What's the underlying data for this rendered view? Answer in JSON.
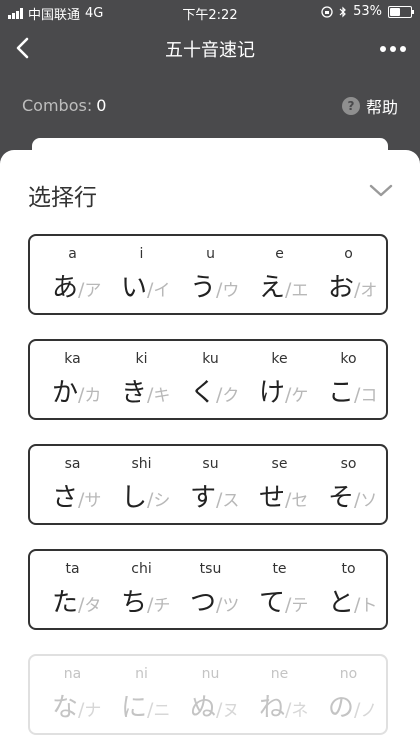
{
  "status_bar": {
    "carrier": "中国联通",
    "network": "4G",
    "time": "下午2:22",
    "battery": "53%",
    "battery_level": 53
  },
  "nav": {
    "title": "五十音速记",
    "back_icon": "chevron-left-icon",
    "more_icon": "more-dots-icon"
  },
  "info": {
    "combos_label": "Combos:",
    "combos_value": "0",
    "help_label": "帮助",
    "help_icon_glyph": "?"
  },
  "sheet": {
    "title": "选择行"
  },
  "rows": [
    {
      "state": "active",
      "cells": [
        {
          "romaji": "a",
          "hira": "あ",
          "kata": "ア"
        },
        {
          "romaji": "i",
          "hira": "い",
          "kata": "イ"
        },
        {
          "romaji": "u",
          "hira": "う",
          "kata": "ウ"
        },
        {
          "romaji": "e",
          "hira": "え",
          "kata": "エ"
        },
        {
          "romaji": "o",
          "hira": "お",
          "kata": "オ"
        }
      ]
    },
    {
      "state": "active",
      "cells": [
        {
          "romaji": "ka",
          "hira": "か",
          "kata": "カ"
        },
        {
          "romaji": "ki",
          "hira": "き",
          "kata": "キ"
        },
        {
          "romaji": "ku",
          "hira": "く",
          "kata": "ク"
        },
        {
          "romaji": "ke",
          "hira": "け",
          "kata": "ケ"
        },
        {
          "romaji": "ko",
          "hira": "こ",
          "kata": "コ"
        }
      ]
    },
    {
      "state": "active",
      "cells": [
        {
          "romaji": "sa",
          "hira": "さ",
          "kata": "サ"
        },
        {
          "romaji": "shi",
          "hira": "し",
          "kata": "シ"
        },
        {
          "romaji": "su",
          "hira": "す",
          "kata": "ス"
        },
        {
          "romaji": "se",
          "hira": "せ",
          "kata": "セ"
        },
        {
          "romaji": "so",
          "hira": "そ",
          "kata": "ソ"
        }
      ]
    },
    {
      "state": "active",
      "cells": [
        {
          "romaji": "ta",
          "hira": "た",
          "kata": "タ"
        },
        {
          "romaji": "chi",
          "hira": "ち",
          "kata": "チ"
        },
        {
          "romaji": "tsu",
          "hira": "つ",
          "kata": "ツ"
        },
        {
          "romaji": "te",
          "hira": "て",
          "kata": "テ"
        },
        {
          "romaji": "to",
          "hira": "と",
          "kata": "ト"
        }
      ]
    },
    {
      "state": "disabled",
      "cells": [
        {
          "romaji": "na",
          "hira": "な",
          "kata": "ナ"
        },
        {
          "romaji": "ni",
          "hira": "に",
          "kata": "ニ"
        },
        {
          "romaji": "nu",
          "hira": "ぬ",
          "kata": "ヌ"
        },
        {
          "romaji": "ne",
          "hira": "ね",
          "kata": "ネ"
        },
        {
          "romaji": "no",
          "hira": "の",
          "kata": "ノ"
        }
      ]
    }
  ],
  "colors": {
    "background": "#4a4a4c",
    "card_border": "#333333",
    "disabled_border": "#e0e0e0",
    "katakana_gray": "#b8b8b8"
  }
}
